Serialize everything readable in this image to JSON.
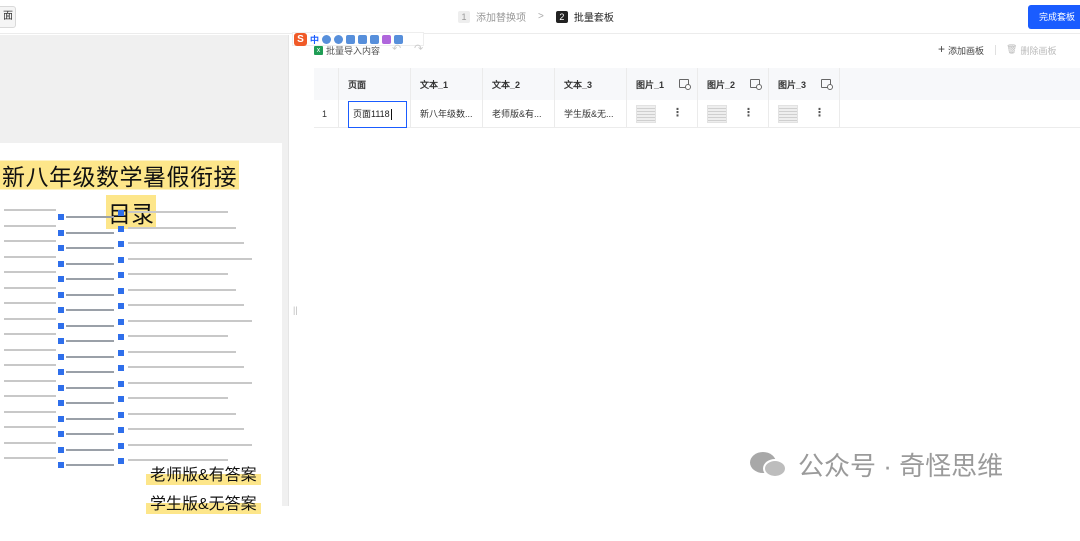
{
  "topbar": {
    "back_label": "面",
    "steps": [
      {
        "num": "1",
        "label": "添加替换项",
        "active": false
      },
      {
        "num": "2",
        "label": "批量套板",
        "active": true
      }
    ],
    "step_separator": ">",
    "finish_label": "完成套板"
  },
  "ime": {
    "zh_label": "中"
  },
  "toolbar": {
    "import_label": "批量导入内容",
    "undo_glyph": "↶",
    "redo_glyph": "↷",
    "add_board_label": "添加画板",
    "delete_board_label": "删除画板"
  },
  "table": {
    "headers": [
      "",
      "页面",
      "文本_1",
      "文本_2",
      "文本_3",
      "图片_1",
      "图片_2",
      "图片_3"
    ],
    "row": {
      "index": "1",
      "page": "页面1118",
      "text_1": "新八年级数...",
      "text_2": "老师版&有...",
      "text_3": "学生版&无..."
    }
  },
  "preview": {
    "title_line1": "新八年级数学暑假衔接",
    "title_line2": "目录",
    "tag1": "老师版&有答案",
    "tag2": "学生版&无答案"
  },
  "watermark": {
    "text": "公众号 · 奇怪思维"
  },
  "colors": {
    "accent": "#1a5cff",
    "highlight": "#fde68a",
    "excel": "#1f9d55",
    "ime_brand": "#f05a28"
  }
}
